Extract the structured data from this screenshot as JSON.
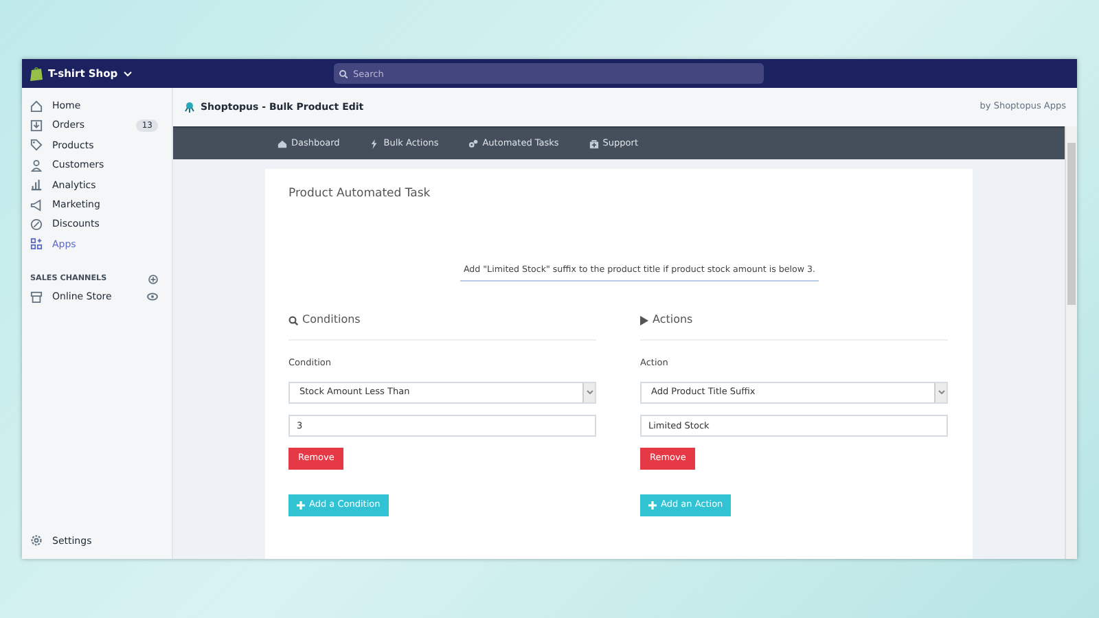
{
  "top_bar": {
    "store_name": "T-shirt Shop",
    "search": {
      "placeholder": "Search"
    }
  },
  "sidebar": {
    "items": [
      {
        "label": "Home",
        "selected": false
      },
      {
        "label": "Orders",
        "selected": false,
        "badge": "13"
      },
      {
        "label": "Products",
        "selected": false
      },
      {
        "label": "Customers",
        "selected": false
      },
      {
        "label": "Analytics",
        "selected": false
      },
      {
        "label": "Marketing",
        "selected": false
      },
      {
        "label": "Discounts",
        "selected": false
      },
      {
        "label": "Apps",
        "selected": true
      }
    ],
    "sales_channels": {
      "heading": "SALES CHANNELS",
      "items": [
        {
          "label": "Online Store"
        }
      ]
    },
    "settings": "Settings"
  },
  "app_header": {
    "title": "Shoptopus - Bulk Product Edit",
    "byline": "by Shoptopus Apps"
  },
  "nav": [
    {
      "label": "Dashboard"
    },
    {
      "label": "Bulk Actions"
    },
    {
      "label": "Automated Tasks"
    },
    {
      "label": "Support"
    }
  ],
  "task": {
    "title": "Product Automated Task",
    "summary": "Add \"Limited Stock\" suffix to the product title if product stock amount is below 3.",
    "sections": [
      {
        "heading": "Conditions",
        "label": "Condition",
        "select": "Stock Amount Less Than",
        "value": "3",
        "remove": "Remove",
        "add": "Add a Condition"
      },
      {
        "heading": "Actions",
        "label": "Action",
        "select": "Add Product Title Suffix",
        "value": "Limited Stock",
        "remove": "Remove",
        "add": "Add an Action"
      }
    ]
  }
}
